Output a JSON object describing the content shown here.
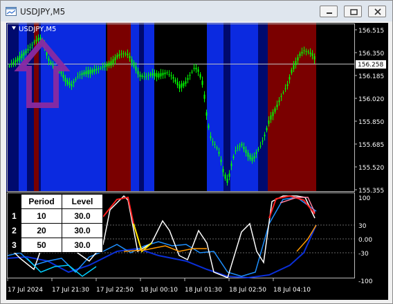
{
  "window": {
    "title": "USDJPY,M5"
  },
  "chart": {
    "symbol_label": "USDJPY,M5",
    "current_price": "156.258",
    "price_ticks": [
      "156.515",
      "156.350",
      "156.185",
      "156.020",
      "155.850",
      "155.685",
      "155.520",
      "155.355"
    ],
    "indicator_ticks": [
      "100",
      "30",
      "0.00",
      "-30",
      "-100"
    ],
    "time_ticks": [
      "17 Jul 2024",
      "17 Jul 21:30",
      "17 Jul 22:50",
      "18 Jul 00:10",
      "18 Jul 01:30",
      "18 Jul 02:50",
      "18 Jul 04:10"
    ],
    "colors": {
      "background": "#000000",
      "bull": "#00ff00",
      "bear": "#00ff00",
      "zone_blue": "#0b2ae0",
      "zone_navy": "#000a6e",
      "zone_red": "#7a0000"
    }
  },
  "table": {
    "headers": [
      "Period",
      "Level"
    ],
    "rows": [
      {
        "no": "1",
        "period": "10",
        "level": "30.0"
      },
      {
        "no": "2",
        "period": "20",
        "level": "30.0"
      },
      {
        "no": "3",
        "period": "50",
        "level": "30.0"
      }
    ]
  },
  "icons": {
    "app": "chart-window-icon",
    "arrow": "up-arrow-marker-icon"
  }
}
